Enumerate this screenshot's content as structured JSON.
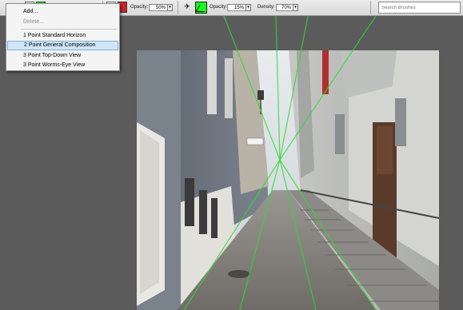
{
  "toolbar": {
    "opacity1_label": "Opacity:",
    "opacity1_value": "50%",
    "opacity2_label": "Opacity:",
    "opacity2_value": "15%",
    "density_label": "Density:",
    "density_value": "70%",
    "guide_color": "#19ff19",
    "secondary_color": "#d12424",
    "search_placeholder": "Search Brushes",
    "dropdown_arrow": "▾"
  },
  "menu": {
    "items": [
      {
        "label": "Add...",
        "state": "normal"
      },
      {
        "label": "Delete...",
        "state": "disabled"
      },
      {
        "label": "1 Point Standard Horizon",
        "state": "normal"
      },
      {
        "label": "2 Point General Composition",
        "state": "selected"
      },
      {
        "label": "3 Point Top-Down View",
        "state": "normal"
      },
      {
        "label": "3 Point Worms-Eye View",
        "state": "normal"
      }
    ]
  },
  "colors": {
    "workspace": "#5b5b5b",
    "guide": "#2fd92f"
  }
}
